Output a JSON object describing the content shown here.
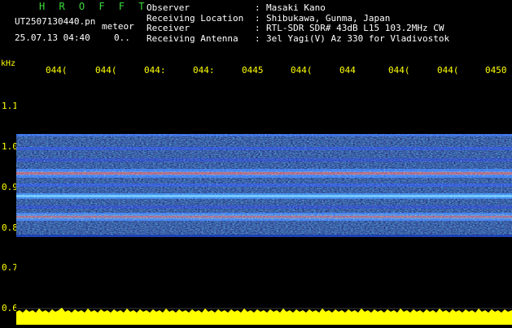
{
  "header": {
    "app_title": "H R O F F T",
    "filename": "UT2507130440.pn",
    "meteor_label": "meteor",
    "datetime": "25.07.13 04:40",
    "count": "0..",
    "meta": [
      {
        "key": "Observer",
        "value": "Masaki Kano"
      },
      {
        "key": "Receiving Location",
        "value": "Shibukawa, Gunma, Japan"
      },
      {
        "key": "Receiver",
        "value": "RTL-SDR SDR# 43dB L15 103.2MHz CW"
      },
      {
        "key": "Receiving Antenna",
        "value": "3el Yagi(V) Az 330 for Vladivostok"
      }
    ]
  },
  "axis": {
    "unit": "kHz",
    "time_ticks": [
      "044(",
      "044(",
      "044:",
      "044:",
      "0445",
      "044(",
      "044",
      "044(",
      "044(",
      "0450"
    ],
    "freq_ticks": [
      "1.1",
      "1.0",
      "0.9",
      "0.8",
      "0.7",
      "0.6"
    ]
  },
  "colors": {
    "header_title": "#3cdc3c",
    "axis_text": "#ffff00",
    "background": "#000000",
    "signal_low": "#0a1aa0",
    "signal_mid": "#3c8cff",
    "signal_high": "#ff3030",
    "noise_floor": "#ffff00"
  }
}
